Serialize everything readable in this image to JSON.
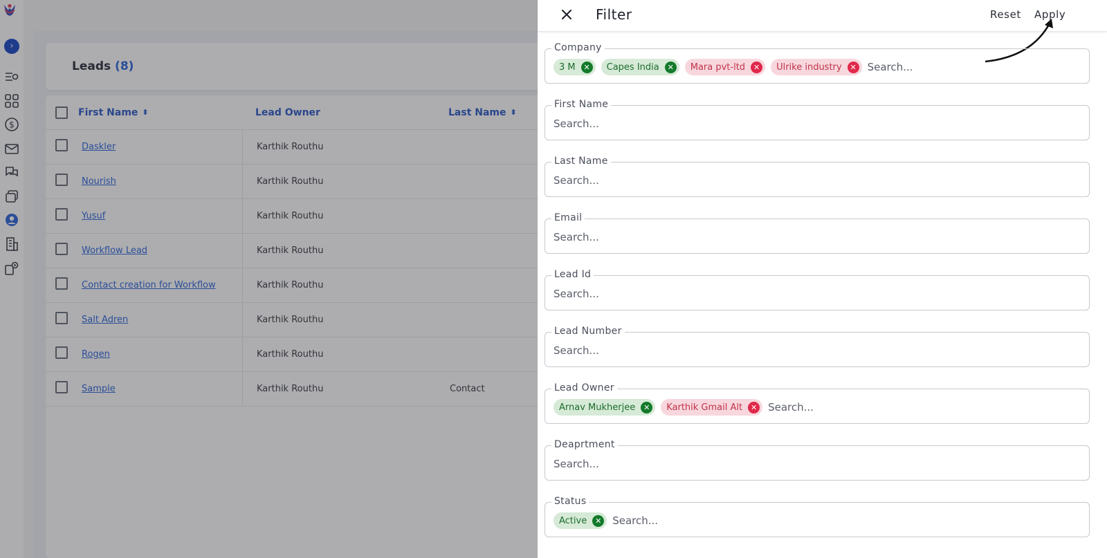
{
  "leads": {
    "title": "Leads",
    "count": "(8)"
  },
  "table": {
    "columns": [
      "First Name",
      "Lead Owner",
      "Last Name"
    ],
    "rows": [
      {
        "first_name": "Daskler",
        "owner": "Karthik Routhu",
        "last_name": ""
      },
      {
        "first_name": "Nourish",
        "owner": "Karthik Routhu",
        "last_name": ""
      },
      {
        "first_name": "Yusuf",
        "owner": "Karthik Routhu",
        "last_name": ""
      },
      {
        "first_name": "Workflow Lead",
        "owner": "Karthik Routhu",
        "last_name": ""
      },
      {
        "first_name": "Contact creation for Workflow",
        "owner": "Karthik Routhu",
        "last_name": ""
      },
      {
        "first_name": "Salt Adren",
        "owner": "Karthik Routhu",
        "last_name": ""
      },
      {
        "first_name": "Rogen",
        "owner": "Karthik Routhu",
        "last_name": ""
      },
      {
        "first_name": "Sample",
        "owner": "Karthik Routhu",
        "last_name": "Contact"
      }
    ]
  },
  "filter": {
    "title": "Filter",
    "reset_label": "Reset",
    "apply_label": "Apply",
    "placeholder": "Search...",
    "fields": [
      {
        "label": "Company",
        "chips": [
          {
            "text": "3 M",
            "tone": "green"
          },
          {
            "text": "Capes India",
            "tone": "green"
          },
          {
            "text": "Mara pvt-ltd",
            "tone": "red"
          },
          {
            "text": "Ulrike industry",
            "tone": "red"
          }
        ]
      },
      {
        "label": "First Name",
        "chips": []
      },
      {
        "label": "Last Name",
        "chips": []
      },
      {
        "label": "Email",
        "chips": []
      },
      {
        "label": "Lead Id",
        "chips": []
      },
      {
        "label": "Lead Number",
        "chips": []
      },
      {
        "label": "Lead Owner",
        "chips": [
          {
            "text": "Arnav Mukherjee",
            "tone": "green"
          },
          {
            "text": "Karthik Gmail Alt",
            "tone": "red"
          }
        ]
      },
      {
        "label": "Deaprtment",
        "chips": []
      },
      {
        "label": "Status",
        "chips": [
          {
            "text": "Active",
            "tone": "green"
          }
        ]
      }
    ]
  },
  "colors": {
    "accent": "#1e5bd8",
    "include_chip": "#137a2a",
    "exclude_chip": "#e0284a"
  }
}
